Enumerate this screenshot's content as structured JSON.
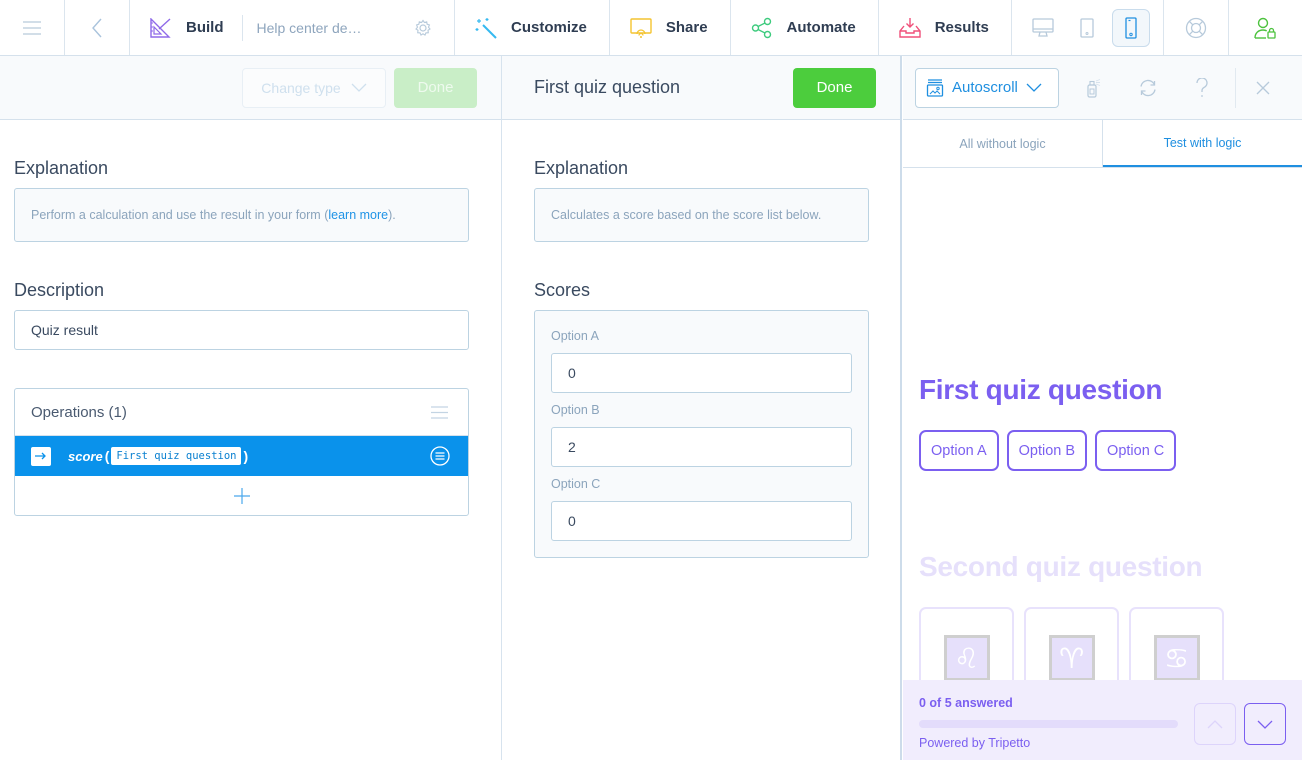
{
  "topnav": {
    "build_label": "Build",
    "form_name": "Help center de…",
    "tabs": [
      {
        "label": "Customize",
        "icon": "magic-wand-icon",
        "color": "#36b9f0"
      },
      {
        "label": "Share",
        "icon": "share-screen-icon",
        "color": "#f4c430"
      },
      {
        "label": "Automate",
        "icon": "automate-nodes-icon",
        "color": "#3ecb7e"
      },
      {
        "label": "Results",
        "icon": "inbox-download-icon",
        "color": "#f0507a"
      }
    ],
    "devices": [
      "desktop",
      "tablet",
      "phone"
    ],
    "active_device": "phone",
    "build_color": "#8f6ae8",
    "account_color": "#4cc23d"
  },
  "left_panel": {
    "change_type_label": "Change type",
    "done_label": "Done",
    "explanation_label": "Explanation",
    "explanation_text_before": "Perform a calculation and use the result in your form (",
    "explanation_link": "learn more",
    "explanation_text_after": ").",
    "description_label": "Description",
    "description_value": "Quiz result",
    "operations_title": "Operations (1)",
    "operations": [
      {
        "function": "score",
        "argument": "First quiz question"
      }
    ]
  },
  "middle_panel": {
    "title": "First quiz question",
    "done_label": "Done",
    "explanation_label": "Explanation",
    "explanation_text": "Calculates a score based on the score list below.",
    "scores_label": "Scores",
    "scores": [
      {
        "option": "Option A",
        "value": "0"
      },
      {
        "option": "Option B",
        "value": "2"
      },
      {
        "option": "Option C",
        "value": "0"
      }
    ]
  },
  "preview": {
    "mode_label": "Autoscroll",
    "tabs": [
      {
        "label": "All without logic",
        "active": false
      },
      {
        "label": "Test with logic",
        "active": true
      }
    ],
    "questions": [
      {
        "title": "First quiz question",
        "options": [
          "Option A",
          "Option B",
          "Option C"
        ]
      },
      {
        "title": "Second quiz question",
        "image_options": [
          "♌",
          "♈",
          "♋"
        ]
      }
    ],
    "progress_text": "0 of 5 answered",
    "progress_fraction": 0,
    "powered_by": "Powered by Tripetto",
    "accent_color": "#7b5ff0"
  }
}
